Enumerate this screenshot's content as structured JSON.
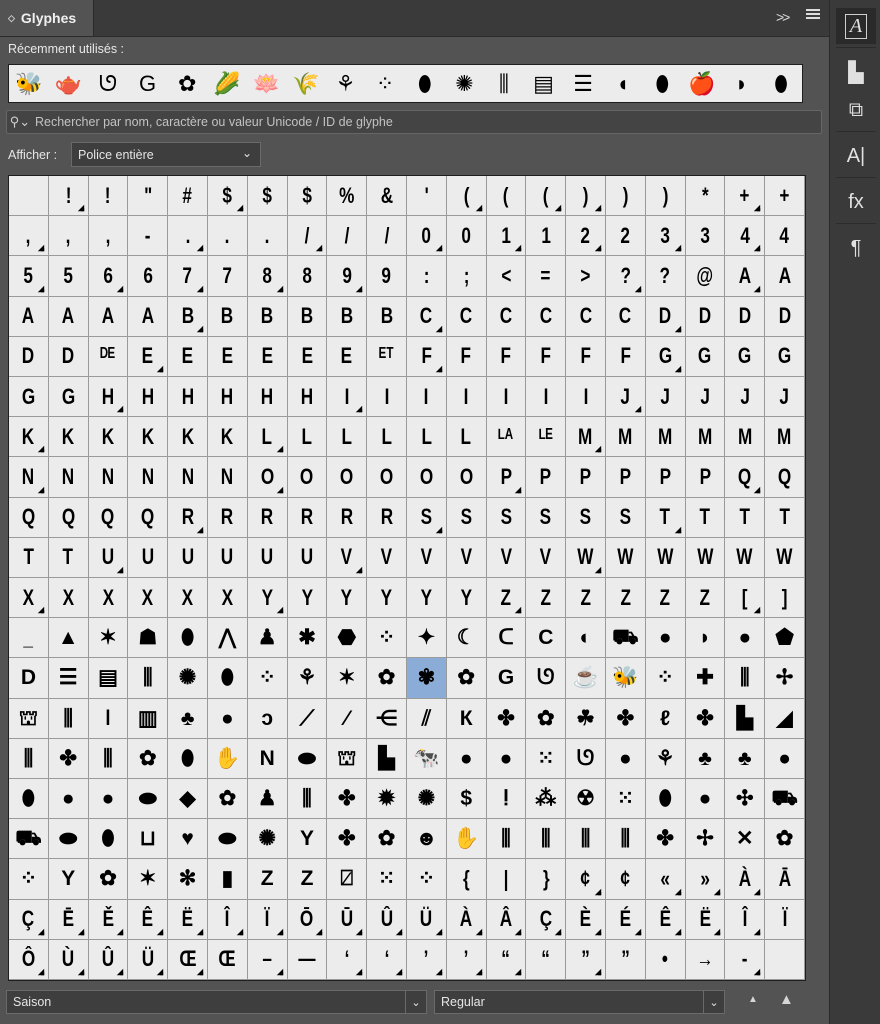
{
  "panel": {
    "tab_title": "Glyphes",
    "collapse_icon": ">>",
    "menu_icon": "menu-icon"
  },
  "recent": {
    "label": "Récemment utilisés :",
    "glyphs": [
      "🐝",
      "🫖",
      "ᘎ",
      "G",
      "✿",
      "🌽",
      "🪷",
      "🌾",
      "⚘",
      "⁘",
      "⬮",
      "✺",
      "⫼",
      "▤",
      "☰",
      "◖",
      "⬮",
      "🍎",
      "◗",
      "⬮"
    ]
  },
  "search": {
    "placeholder": "Rechercher par nom, caractère ou valeur Unicode / ID de glyphe"
  },
  "show": {
    "label": "Afficher :",
    "value": "Police entière"
  },
  "grid": {
    "selected_index": 250,
    "cells": [
      {
        "c": ""
      },
      {
        "c": "!",
        "t": 1
      },
      {
        "c": "!"
      },
      {
        "c": "\""
      },
      {
        "c": "#"
      },
      {
        "c": "$",
        "t": 1
      },
      {
        "c": "$"
      },
      {
        "c": "$"
      },
      {
        "c": "%"
      },
      {
        "c": "&"
      },
      {
        "c": "'"
      },
      {
        "c": "(",
        "t": 1
      },
      {
        "c": "("
      },
      {
        "c": "(",
        "t": 1
      },
      {
        "c": ")",
        "t": 1
      },
      {
        "c": ")"
      },
      {
        "c": ")"
      },
      {
        "c": "*"
      },
      {
        "c": "+",
        "t": 1
      },
      {
        "c": "+"
      },
      {
        "c": ",",
        "t": 1
      },
      {
        "c": ","
      },
      {
        "c": ","
      },
      {
        "c": "-"
      },
      {
        "c": ".",
        "t": 1
      },
      {
        "c": "."
      },
      {
        "c": "."
      },
      {
        "c": "/",
        "t": 1
      },
      {
        "c": "/"
      },
      {
        "c": "/"
      },
      {
        "c": "0",
        "t": 1
      },
      {
        "c": "0"
      },
      {
        "c": "1",
        "t": 1
      },
      {
        "c": "1"
      },
      {
        "c": "2",
        "t": 1
      },
      {
        "c": "2"
      },
      {
        "c": "3",
        "t": 1
      },
      {
        "c": "3"
      },
      {
        "c": "4",
        "t": 1
      },
      {
        "c": "4"
      },
      {
        "c": "5",
        "t": 1
      },
      {
        "c": "5"
      },
      {
        "c": "6",
        "t": 1
      },
      {
        "c": "6"
      },
      {
        "c": "7",
        "t": 1
      },
      {
        "c": "7"
      },
      {
        "c": "8",
        "t": 1
      },
      {
        "c": "8"
      },
      {
        "c": "9",
        "t": 1
      },
      {
        "c": "9"
      },
      {
        "c": ":"
      },
      {
        "c": ";"
      },
      {
        "c": "<"
      },
      {
        "c": "="
      },
      {
        "c": ">"
      },
      {
        "c": "?",
        "t": 1
      },
      {
        "c": "?"
      },
      {
        "c": "@"
      },
      {
        "c": "A",
        "t": 1
      },
      {
        "c": "A"
      },
      {
        "c": "A"
      },
      {
        "c": "A"
      },
      {
        "c": "A"
      },
      {
        "c": "A"
      },
      {
        "c": "B",
        "t": 1
      },
      {
        "c": "B"
      },
      {
        "c": "B"
      },
      {
        "c": "B"
      },
      {
        "c": "B"
      },
      {
        "c": "B"
      },
      {
        "c": "C",
        "t": 1
      },
      {
        "c": "C"
      },
      {
        "c": "C"
      },
      {
        "c": "C"
      },
      {
        "c": "C"
      },
      {
        "c": "C"
      },
      {
        "c": "D",
        "t": 1
      },
      {
        "c": "D"
      },
      {
        "c": "D"
      },
      {
        "c": "D"
      },
      {
        "c": "D"
      },
      {
        "c": "D"
      },
      {
        "c": "ᴰᴱ"
      },
      {
        "c": "E",
        "t": 1
      },
      {
        "c": "E"
      },
      {
        "c": "E"
      },
      {
        "c": "E"
      },
      {
        "c": "E"
      },
      {
        "c": "E"
      },
      {
        "c": "ᴱᵀ"
      },
      {
        "c": "F",
        "t": 1
      },
      {
        "c": "F"
      },
      {
        "c": "F"
      },
      {
        "c": "F"
      },
      {
        "c": "F"
      },
      {
        "c": "F"
      },
      {
        "c": "G",
        "t": 1
      },
      {
        "c": "G"
      },
      {
        "c": "G"
      },
      {
        "c": "G"
      },
      {
        "c": "G"
      },
      {
        "c": "G"
      },
      {
        "c": "H",
        "t": 1
      },
      {
        "c": "H"
      },
      {
        "c": "H"
      },
      {
        "c": "H"
      },
      {
        "c": "H"
      },
      {
        "c": "H"
      },
      {
        "c": "I",
        "t": 1
      },
      {
        "c": "I"
      },
      {
        "c": "I"
      },
      {
        "c": "I"
      },
      {
        "c": "I"
      },
      {
        "c": "I"
      },
      {
        "c": "I"
      },
      {
        "c": "J",
        "t": 1
      },
      {
        "c": "J"
      },
      {
        "c": "J"
      },
      {
        "c": "J"
      },
      {
        "c": "J"
      },
      {
        "c": "K",
        "t": 1
      },
      {
        "c": "K"
      },
      {
        "c": "K"
      },
      {
        "c": "K"
      },
      {
        "c": "K"
      },
      {
        "c": "K"
      },
      {
        "c": "L",
        "t": 1
      },
      {
        "c": "L"
      },
      {
        "c": "L"
      },
      {
        "c": "L"
      },
      {
        "c": "L"
      },
      {
        "c": "L"
      },
      {
        "c": "ᴸᴬ"
      },
      {
        "c": "ᴸᴱ"
      },
      {
        "c": "M",
        "t": 1
      },
      {
        "c": "M"
      },
      {
        "c": "M"
      },
      {
        "c": "M"
      },
      {
        "c": "M"
      },
      {
        "c": "M"
      },
      {
        "c": "N",
        "t": 1
      },
      {
        "c": "N"
      },
      {
        "c": "N"
      },
      {
        "c": "N"
      },
      {
        "c": "N"
      },
      {
        "c": "N"
      },
      {
        "c": "O",
        "t": 1
      },
      {
        "c": "O"
      },
      {
        "c": "O"
      },
      {
        "c": "O"
      },
      {
        "c": "O"
      },
      {
        "c": "O"
      },
      {
        "c": "P",
        "t": 1
      },
      {
        "c": "P"
      },
      {
        "c": "P"
      },
      {
        "c": "P"
      },
      {
        "c": "P"
      },
      {
        "c": "P"
      },
      {
        "c": "Q",
        "t": 1
      },
      {
        "c": "Q"
      },
      {
        "c": "Q"
      },
      {
        "c": "Q"
      },
      {
        "c": "Q"
      },
      {
        "c": "Q"
      },
      {
        "c": "R",
        "t": 1
      },
      {
        "c": "R"
      },
      {
        "c": "R"
      },
      {
        "c": "R"
      },
      {
        "c": "R"
      },
      {
        "c": "R"
      },
      {
        "c": "S",
        "t": 1
      },
      {
        "c": "S"
      },
      {
        "c": "S"
      },
      {
        "c": "S"
      },
      {
        "c": "S"
      },
      {
        "c": "S"
      },
      {
        "c": "T",
        "t": 1
      },
      {
        "c": "T"
      },
      {
        "c": "T"
      },
      {
        "c": "T"
      },
      {
        "c": "T"
      },
      {
        "c": "T"
      },
      {
        "c": "U",
        "t": 1
      },
      {
        "c": "U"
      },
      {
        "c": "U"
      },
      {
        "c": "U"
      },
      {
        "c": "U"
      },
      {
        "c": "U"
      },
      {
        "c": "V",
        "t": 1
      },
      {
        "c": "V"
      },
      {
        "c": "V"
      },
      {
        "c": "V"
      },
      {
        "c": "V"
      },
      {
        "c": "V"
      },
      {
        "c": "W",
        "t": 1
      },
      {
        "c": "W"
      },
      {
        "c": "W"
      },
      {
        "c": "W"
      },
      {
        "c": "W"
      },
      {
        "c": "W"
      },
      {
        "c": "X",
        "t": 1
      },
      {
        "c": "X"
      },
      {
        "c": "X"
      },
      {
        "c": "X"
      },
      {
        "c": "X"
      },
      {
        "c": "X"
      },
      {
        "c": "Y",
        "t": 1
      },
      {
        "c": "Y"
      },
      {
        "c": "Y"
      },
      {
        "c": "Y"
      },
      {
        "c": "Y"
      },
      {
        "c": "Y"
      },
      {
        "c": "Z",
        "t": 1
      },
      {
        "c": "Z"
      },
      {
        "c": "Z"
      },
      {
        "c": "Z"
      },
      {
        "c": "Z"
      },
      {
        "c": "Z"
      },
      {
        "c": "[",
        "t": 1
      },
      {
        "c": "]"
      },
      {
        "c": "_"
      },
      {
        "c": "▲",
        "p": 1
      },
      {
        "c": "✶",
        "p": 1
      },
      {
        "c": "☗",
        "p": 1
      },
      {
        "c": "⬮",
        "p": 1
      },
      {
        "c": "⋀",
        "p": 1
      },
      {
        "c": "♟",
        "p": 1
      },
      {
        "c": "✱",
        "p": 1
      },
      {
        "c": "⬣",
        "p": 1
      },
      {
        "c": "⁘",
        "p": 1
      },
      {
        "c": "✦",
        "p": 1
      },
      {
        "c": "☾",
        "p": 1
      },
      {
        "c": "ᑕ",
        "p": 1
      },
      {
        "c": "C",
        "p": 1
      },
      {
        "c": "◐",
        "p": 1
      },
      {
        "c": "⛟",
        "p": 1
      },
      {
        "c": "●",
        "p": 1
      },
      {
        "c": "◗",
        "p": 1
      },
      {
        "c": "●",
        "p": 1
      },
      {
        "c": "⬟",
        "p": 1
      },
      {
        "c": "D",
        "p": 1
      },
      {
        "c": "☰",
        "p": 1
      },
      {
        "c": "▤",
        "p": 1
      },
      {
        "c": "⫼",
        "p": 1
      },
      {
        "c": "✺",
        "p": 1
      },
      {
        "c": "⬮",
        "p": 1
      },
      {
        "c": "⁘",
        "p": 1
      },
      {
        "c": "⚘",
        "p": 1
      },
      {
        "c": "✶",
        "p": 1
      },
      {
        "c": "✿",
        "p": 1
      },
      {
        "c": "✾",
        "p": 1
      },
      {
        "c": "✿",
        "p": 1
      },
      {
        "c": "G",
        "p": 1
      },
      {
        "c": "ᘎ",
        "p": 1
      },
      {
        "c": "☕",
        "p": 1
      },
      {
        "c": "🐝",
        "p": 1
      },
      {
        "c": "⁘",
        "p": 1
      },
      {
        "c": "✚",
        "p": 1
      },
      {
        "c": "⫼",
        "p": 1
      },
      {
        "c": "✢",
        "p": 1
      },
      {
        "c": "⛫",
        "p": 1
      },
      {
        "c": "⫼",
        "p": 1
      },
      {
        "c": "ǀ",
        "p": 1
      },
      {
        "c": "▥",
        "p": 1
      },
      {
        "c": "♣",
        "p": 1
      },
      {
        "c": "●",
        "p": 1
      },
      {
        "c": "ↄ",
        "p": 1
      },
      {
        "c": "⟋",
        "p": 1
      },
      {
        "c": "⁄",
        "p": 1
      },
      {
        "c": "⋲",
        "p": 1
      },
      {
        "c": "⫽",
        "p": 1
      },
      {
        "c": "К",
        "p": 1
      },
      {
        "c": "✤",
        "p": 1
      },
      {
        "c": "✿",
        "p": 1
      },
      {
        "c": "☘",
        "p": 1
      },
      {
        "c": "✤",
        "p": 1
      },
      {
        "c": "ℓ",
        "p": 1
      },
      {
        "c": "✤",
        "p": 1
      },
      {
        "c": "▙",
        "p": 1
      },
      {
        "c": "◢",
        "p": 1
      },
      {
        "c": "⫼",
        "p": 1
      },
      {
        "c": "✤",
        "p": 1
      },
      {
        "c": "⫼",
        "p": 1
      },
      {
        "c": "✿",
        "p": 1
      },
      {
        "c": "⬮",
        "p": 1
      },
      {
        "c": "✋",
        "p": 1
      },
      {
        "c": "N",
        "p": 1
      },
      {
        "c": "⬬",
        "p": 1
      },
      {
        "c": "⛫",
        "p": 1
      },
      {
        "c": "▙",
        "p": 1
      },
      {
        "c": "🐄",
        "p": 1
      },
      {
        "c": "●",
        "p": 1
      },
      {
        "c": "●",
        "p": 1
      },
      {
        "c": "⁙",
        "p": 1
      },
      {
        "c": "ᘎ",
        "p": 1
      },
      {
        "c": "●",
        "p": 1
      },
      {
        "c": "⚘",
        "p": 1
      },
      {
        "c": "♣",
        "p": 1
      },
      {
        "c": "♣",
        "p": 1
      },
      {
        "c": "●",
        "p": 1
      },
      {
        "c": "⬮",
        "p": 1
      },
      {
        "c": "●",
        "p": 1
      },
      {
        "c": "●",
        "p": 1
      },
      {
        "c": "⬬",
        "p": 1
      },
      {
        "c": "◆",
        "p": 1
      },
      {
        "c": "✿",
        "p": 1
      },
      {
        "c": "♟",
        "p": 1
      },
      {
        "c": "⫼",
        "p": 1
      },
      {
        "c": "✤",
        "p": 1
      },
      {
        "c": "✹",
        "p": 1
      },
      {
        "c": "✺",
        "p": 1
      },
      {
        "c": "$",
        "p": 1
      },
      {
        "c": "ⵑ",
        "p": 1
      },
      {
        "c": "⁂",
        "p": 1
      },
      {
        "c": "☢",
        "p": 1
      },
      {
        "c": "⁙",
        "p": 1
      },
      {
        "c": "⬮",
        "p": 1
      },
      {
        "c": "●",
        "p": 1
      },
      {
        "c": "✣",
        "p": 1
      },
      {
        "c": "⛟",
        "p": 1
      },
      {
        "c": "⛟",
        "p": 1
      },
      {
        "c": "⬬",
        "p": 1
      },
      {
        "c": "⬮",
        "p": 1
      },
      {
        "c": "⊔",
        "p": 1
      },
      {
        "c": "♥",
        "p": 1
      },
      {
        "c": "⬬",
        "p": 1
      },
      {
        "c": "✺",
        "p": 1
      },
      {
        "c": "Y",
        "p": 1
      },
      {
        "c": "✤",
        "p": 1
      },
      {
        "c": "✿",
        "p": 1
      },
      {
        "c": "☻",
        "p": 1
      },
      {
        "c": "✋",
        "p": 1
      },
      {
        "c": "⫼",
        "p": 1
      },
      {
        "c": "⫼",
        "p": 1
      },
      {
        "c": "⫼",
        "p": 1
      },
      {
        "c": "⫼",
        "p": 1
      },
      {
        "c": "✤",
        "p": 1
      },
      {
        "c": "✢",
        "p": 1
      },
      {
        "c": "✕",
        "p": 1
      },
      {
        "c": "✿",
        "p": 1
      },
      {
        "c": "⁘",
        "p": 1
      },
      {
        "c": "Y",
        "p": 1
      },
      {
        "c": "✿",
        "p": 1
      },
      {
        "c": "✶",
        "p": 1
      },
      {
        "c": "✻",
        "p": 1
      },
      {
        "c": "▮",
        "p": 1
      },
      {
        "c": "Z",
        "p": 1
      },
      {
        "c": "Z",
        "p": 1
      },
      {
        "c": "⍁",
        "p": 1
      },
      {
        "c": "⁙",
        "p": 1
      },
      {
        "c": "⁘",
        "p": 1
      },
      {
        "c": "{"
      },
      {
        "c": "|"
      },
      {
        "c": "}"
      },
      {
        "c": "¢",
        "t": 1
      },
      {
        "c": "¢"
      },
      {
        "c": "«",
        "t": 1
      },
      {
        "c": "»",
        "t": 1
      },
      {
        "c": "À",
        "t": 1
      },
      {
        "c": "Ā"
      },
      {
        "c": "Ç",
        "t": 1
      },
      {
        "c": "Ē",
        "t": 1
      },
      {
        "c": "Ě",
        "t": 1
      },
      {
        "c": "Ê",
        "t": 1
      },
      {
        "c": "Ë",
        "t": 1
      },
      {
        "c": "Î",
        "t": 1
      },
      {
        "c": "Ï",
        "t": 1
      },
      {
        "c": "Ō",
        "t": 1
      },
      {
        "c": "Ū",
        "t": 1
      },
      {
        "c": "Û",
        "t": 1
      },
      {
        "c": "Ü",
        "t": 1
      },
      {
        "c": "À",
        "t": 1
      },
      {
        "c": "Â",
        "t": 1
      },
      {
        "c": "Ç",
        "t": 1
      },
      {
        "c": "È",
        "t": 1
      },
      {
        "c": "É",
        "t": 1
      },
      {
        "c": "Ê",
        "t": 1
      },
      {
        "c": "Ë",
        "t": 1
      },
      {
        "c": "Î",
        "t": 1
      },
      {
        "c": "Ï"
      },
      {
        "c": "Ô",
        "t": 1
      },
      {
        "c": "Ù",
        "t": 1
      },
      {
        "c": "Û",
        "t": 1
      },
      {
        "c": "Ü",
        "t": 1
      },
      {
        "c": "Œ",
        "t": 1
      },
      {
        "c": "Œ"
      },
      {
        "c": "–",
        "t": 1
      },
      {
        "c": "—"
      },
      {
        "c": "‘",
        "t": 1
      },
      {
        "c": "‘",
        "t": 1
      },
      {
        "c": "’",
        "t": 1
      },
      {
        "c": "’",
        "t": 1
      },
      {
        "c": "“",
        "t": 1
      },
      {
        "c": "“"
      },
      {
        "c": "”",
        "t": 1
      },
      {
        "c": "”"
      },
      {
        "c": "•"
      },
      {
        "c": "→"
      },
      {
        "c": "-",
        "t": 1
      },
      {
        "c": ""
      }
    ]
  },
  "bottom": {
    "font_family": "Saison",
    "font_style": "Regular"
  },
  "sidebar": {
    "buttons": [
      "A",
      "▙",
      "⧉",
      "A|",
      "fx",
      "¶"
    ]
  },
  "colors": {
    "panel_bg": "#535353",
    "grid_bg": "#ececec",
    "selected_cell": "#8bacd6"
  }
}
